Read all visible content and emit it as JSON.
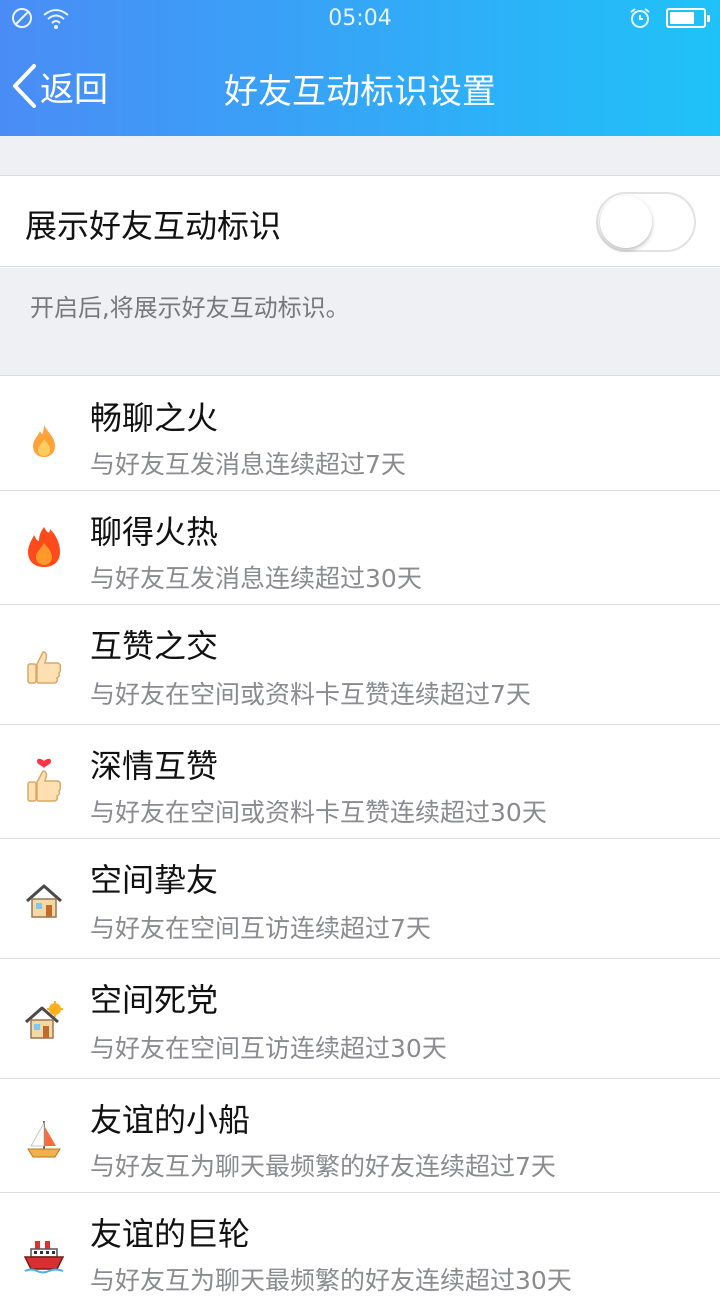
{
  "status_bar": {
    "time": "05:04",
    "battery_level": 0.75
  },
  "nav": {
    "back_label": "返回",
    "title": "好友互动标识设置"
  },
  "toggle": {
    "label": "展示好友互动标识",
    "enabled": false
  },
  "description": "开启后,将展示好友互动标识。",
  "items": [
    {
      "title": "畅聊之火",
      "subtitle": "与好友互发消息连续超过7天",
      "icon": "small-flame-icon"
    },
    {
      "title": "聊得火热",
      "subtitle": "与好友互发消息连续超过30天",
      "icon": "big-flame-icon"
    },
    {
      "title": "互赞之交",
      "subtitle": "与好友在空间或资料卡互赞连续超过7天",
      "icon": "thumbs-up-icon"
    },
    {
      "title": "深情互赞",
      "subtitle": "与好友在空间或资料卡互赞连续超过30天",
      "icon": "heart-thumbs-up-icon"
    },
    {
      "title": "空间挚友",
      "subtitle": "与好友在空间互访连续超过7天",
      "icon": "house-icon"
    },
    {
      "title": "空间死党",
      "subtitle": "与好友在空间互访连续超过30天",
      "icon": "house-sun-icon"
    },
    {
      "title": "友谊的小船",
      "subtitle": "与好友互为聊天最频繁的好友连续超过7天",
      "icon": "sailboat-icon"
    },
    {
      "title": "友谊的巨轮",
      "subtitle": "与好友互为聊天最频繁的好友连续超过30天",
      "icon": "ship-icon"
    }
  ]
}
